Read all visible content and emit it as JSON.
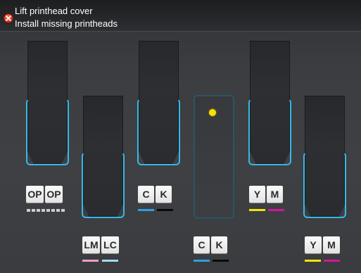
{
  "header": {
    "line1": "Lift printhead cover",
    "line2": "Install missing printheads",
    "status_icon": "error-icon",
    "status_color": "#d42a17"
  },
  "slots": [
    {
      "id": "op",
      "label_left": "OP",
      "label_right": "OP",
      "installed": true
    },
    {
      "id": "lm-lc",
      "label_left": "LM",
      "label_right": "LC",
      "installed": true,
      "color_left": "#f09cc8",
      "color_right": "#9fdcf2"
    },
    {
      "id": "c-k-1",
      "label_left": "C",
      "label_right": "K",
      "installed": true,
      "color_left": "#2e9fe0",
      "color_right": "#0a0a0a"
    },
    {
      "id": "c-k-2",
      "label_left": "C",
      "label_right": "K",
      "installed": false,
      "color_left": "#2e9fe0",
      "color_right": "#0a0a0a"
    },
    {
      "id": "y-m-1",
      "label_left": "Y",
      "label_right": "M",
      "installed": true,
      "color_left": "#f4e400",
      "color_right": "#d3169a"
    },
    {
      "id": "y-m-2",
      "label_left": "Y",
      "label_right": "M",
      "installed": true,
      "color_left": "#f4e400",
      "color_right": "#d3169a"
    }
  ],
  "colors": {
    "slot_highlight": "#36b8e8",
    "missing_indicator": "#f8e000"
  }
}
